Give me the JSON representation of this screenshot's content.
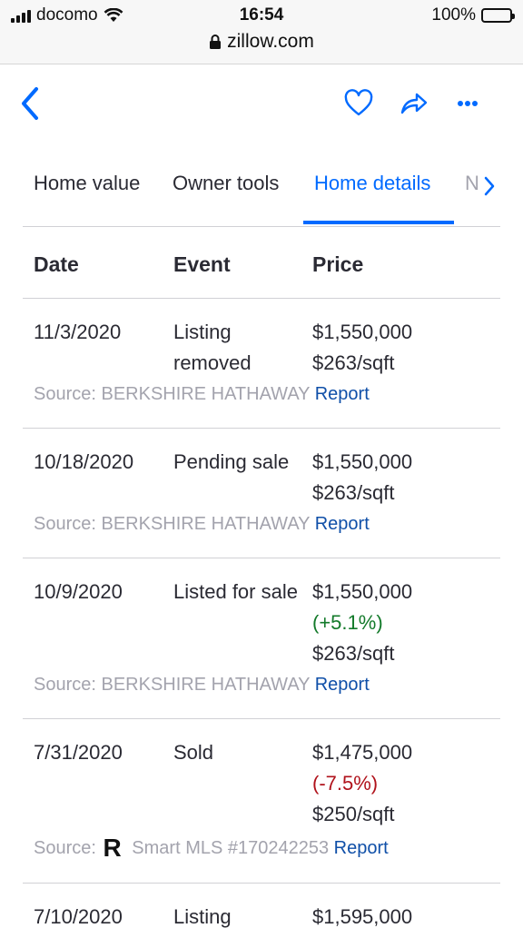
{
  "status": {
    "carrier": "docomo",
    "time": "16:54",
    "battery": "100%",
    "url": "zillow.com"
  },
  "tabs": [
    {
      "label": "Home value"
    },
    {
      "label": "Owner tools"
    },
    {
      "label": "Home details"
    },
    {
      "label": "N"
    }
  ],
  "table": {
    "headers": {
      "date": "Date",
      "event": "Event",
      "price": "Price"
    },
    "rows": [
      {
        "date": "11/3/2020",
        "event": "Listing removed",
        "price": "$1,550,000",
        "change": "",
        "psf": "$263/sqft",
        "source": "Source: BERKSHIRE HATHAWAY",
        "report": "Report"
      },
      {
        "date": "10/18/2020",
        "event": "Pending sale",
        "price": "$1,550,000",
        "change": "",
        "psf": "$263/sqft",
        "source": "Source: BERKSHIRE HATHAWAY",
        "report": "Report"
      },
      {
        "date": "10/9/2020",
        "event": "Listed for sale",
        "price": "$1,550,000",
        "change": "(+5.1%)",
        "psf": "$263/sqft",
        "source": "Source: BERKSHIRE HATHAWAY",
        "report": "Report"
      },
      {
        "date": "7/31/2020",
        "event": "Sold",
        "price": "$1,475,000",
        "change": "(-7.5%)",
        "psf": "$250/sqft",
        "source_prefix": "Source:",
        "source_logo": "R",
        "source": "Smart MLS #170242253",
        "report": "Report"
      },
      {
        "date": "7/10/2020",
        "event": "Listing",
        "price": "$1,595,000"
      }
    ]
  },
  "colors": {
    "accent": "#006aff",
    "positive": "#137a2a",
    "negative": "#b0121b",
    "link": "#0f4fa8"
  }
}
